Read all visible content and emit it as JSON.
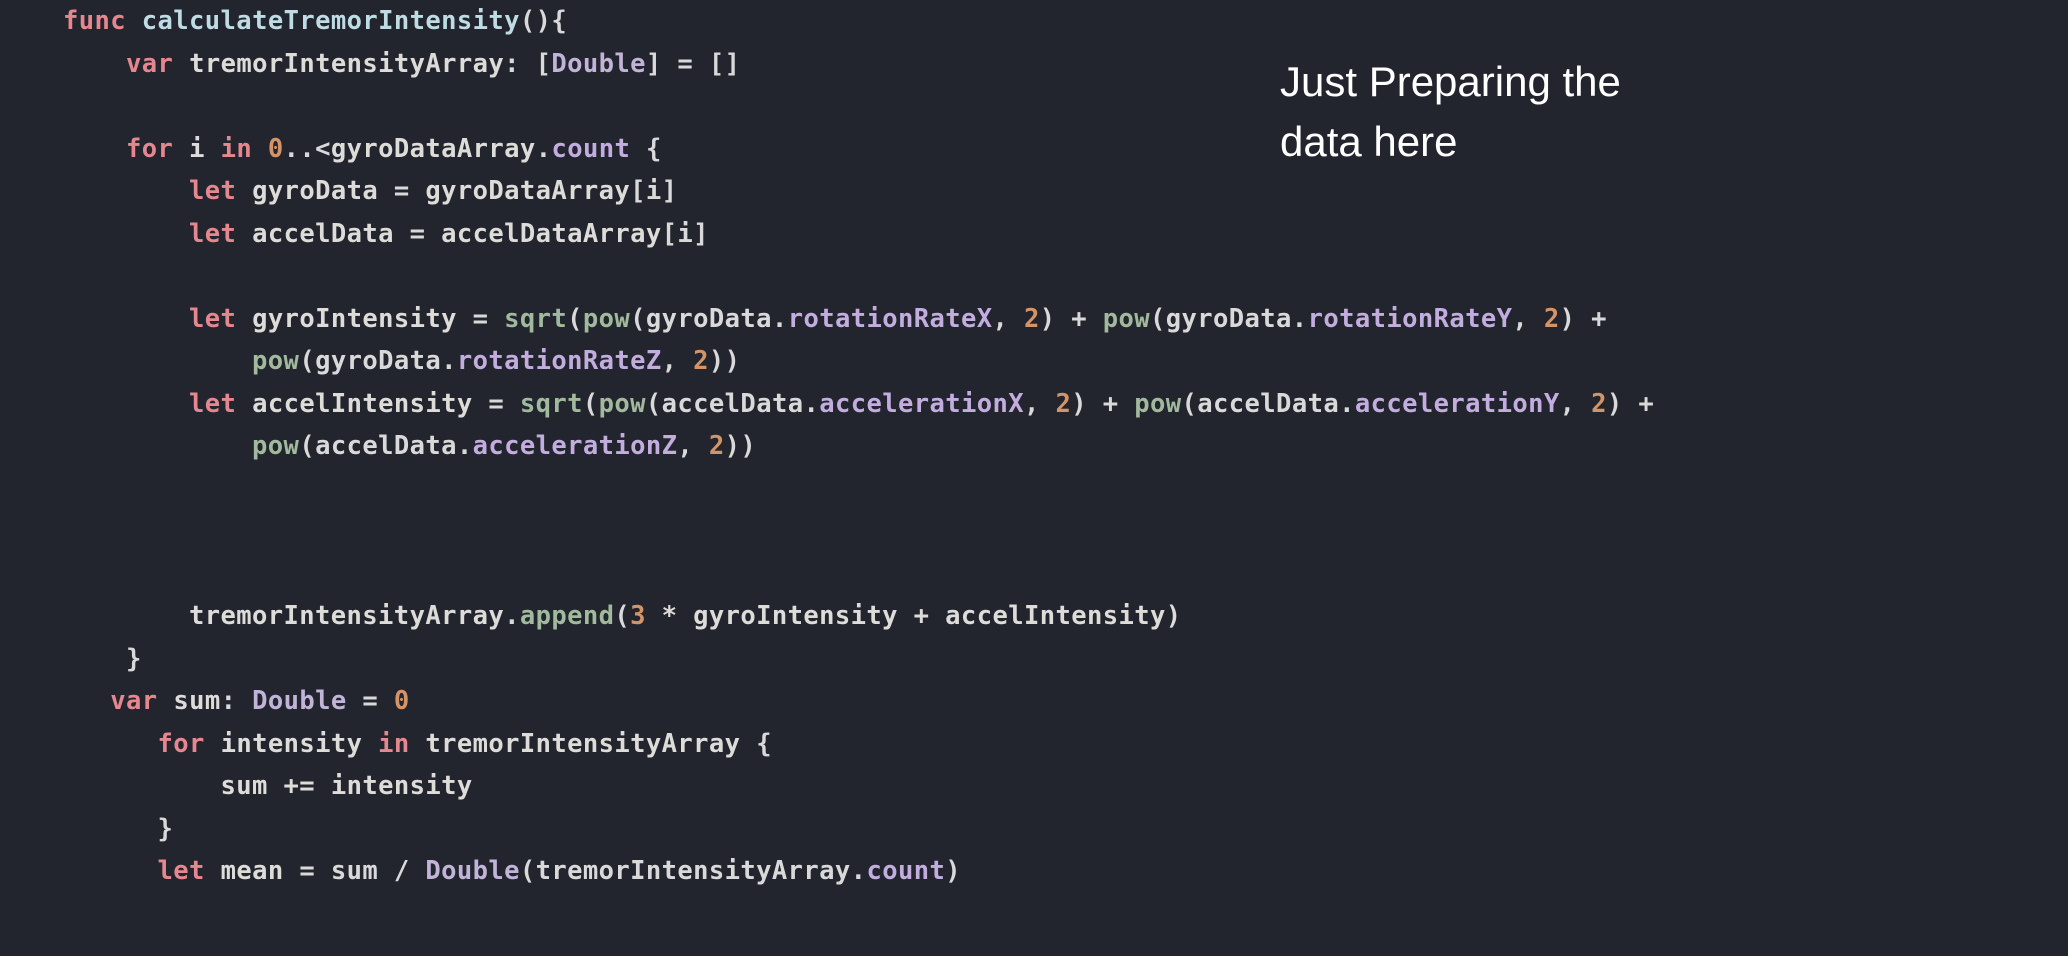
{
  "annotation": {
    "line1": "Just Preparing the",
    "line2": "data here"
  },
  "code": {
    "l1": {
      "indent": "    ",
      "func": "func",
      "sp1": " ",
      "name": "calculateTremorIntensity",
      "parens": "()",
      "brace": "{"
    },
    "l2": {
      "indent": "        ",
      "var": "var",
      "sp1": " ",
      "id": "tremorIntensityArray",
      "colon": ": [",
      "type": "Double",
      "close": "] = []"
    },
    "l3": {
      "indent": ""
    },
    "l4": {
      "indent": "        ",
      "for": "for",
      "sp1": " ",
      "i": "i",
      "sp2": " ",
      "in": "in",
      "sp3": " ",
      "zero": "0",
      "range": "..<",
      "arr": "gyroDataArray",
      "dot": ".",
      "count": "count",
      "sp4": " ",
      "brace": "{"
    },
    "l5": {
      "indent": "            ",
      "let": "let",
      "sp1": " ",
      "id": "gyroData",
      "eq": " = ",
      "arr": "gyroDataArray",
      "idx": "[i]"
    },
    "l6": {
      "indent": "            ",
      "let": "let",
      "sp1": " ",
      "id": "accelData",
      "eq": " = ",
      "arr": "accelDataArray",
      "idx": "[i]"
    },
    "l7": {
      "indent": ""
    },
    "l8": {
      "indent": "            ",
      "let": "let",
      "sp1": " ",
      "id": "gyroIntensity",
      "eq": " = ",
      "sqrt": "sqrt",
      "op": "(",
      "pow1": "pow",
      "p1": "(gyroData.",
      "rx": "rotationRateX",
      "c1": ", ",
      "two1": "2",
      "cp1": ") + ",
      "pow2": "pow",
      "p2": "(gyroData.",
      "ry": "rotationRateY",
      "c2": ", ",
      "two2": "2",
      "cp2": ") + "
    },
    "l9": {
      "indent": "                ",
      "pow3": "pow",
      "p3": "(gyroData.",
      "rz": "rotationRateZ",
      "c3": ", ",
      "two3": "2",
      "cp3": "))"
    },
    "l10": {
      "indent": "            ",
      "let": "let",
      "sp1": " ",
      "id": "accelIntensity",
      "eq": " = ",
      "sqrt": "sqrt",
      "op": "(",
      "pow1": "pow",
      "p1": "(accelData.",
      "ax": "accelerationX",
      "c1": ", ",
      "two1": "2",
      "cp1": ") + ",
      "pow2": "pow",
      "p2": "(accelData.",
      "ay": "accelerationY",
      "c2": ", ",
      "two2": "2",
      "cp2": ") + "
    },
    "l11": {
      "indent": "                ",
      "pow3": "pow",
      "p3": "(accelData.",
      "az": "accelerationZ",
      "c3": ", ",
      "two3": "2",
      "cp3": "))"
    },
    "l12": {
      "indent": ""
    },
    "l13": {
      "indent": ""
    },
    "l14": {
      "indent": ""
    },
    "l15": {
      "indent": "            ",
      "arr": "tremorIntensityArray",
      "dot": ".",
      "append": "append",
      "op": "(",
      "three": "3",
      "expr": " * gyroIntensity + accelIntensity)"
    },
    "l16": {
      "indent": "        ",
      "brace": "}"
    },
    "l17": {
      "indent": "       ",
      "var": "var",
      "sp1": " ",
      "id": "sum",
      "colon": ": ",
      "type": "Double",
      "eq": " = ",
      "zero": "0"
    },
    "l18": {
      "indent": "          ",
      "for": "for",
      "sp1": " ",
      "id": "intensity",
      "sp2": " ",
      "in": "in",
      "sp3": " ",
      "arr": "tremorIntensityArray",
      "sp4": " ",
      "brace": "{"
    },
    "l19": {
      "indent": "              ",
      "id": "sum += intensity"
    },
    "l20": {
      "indent": "          ",
      "brace": "}"
    },
    "l21": {
      "indent": "          ",
      "let": "let",
      "sp1": " ",
      "id": "mean",
      "eq": " = sum / ",
      "type": "Double",
      "op": "(tremorIntensityArray.",
      "count": "count",
      "cp": ")"
    }
  }
}
